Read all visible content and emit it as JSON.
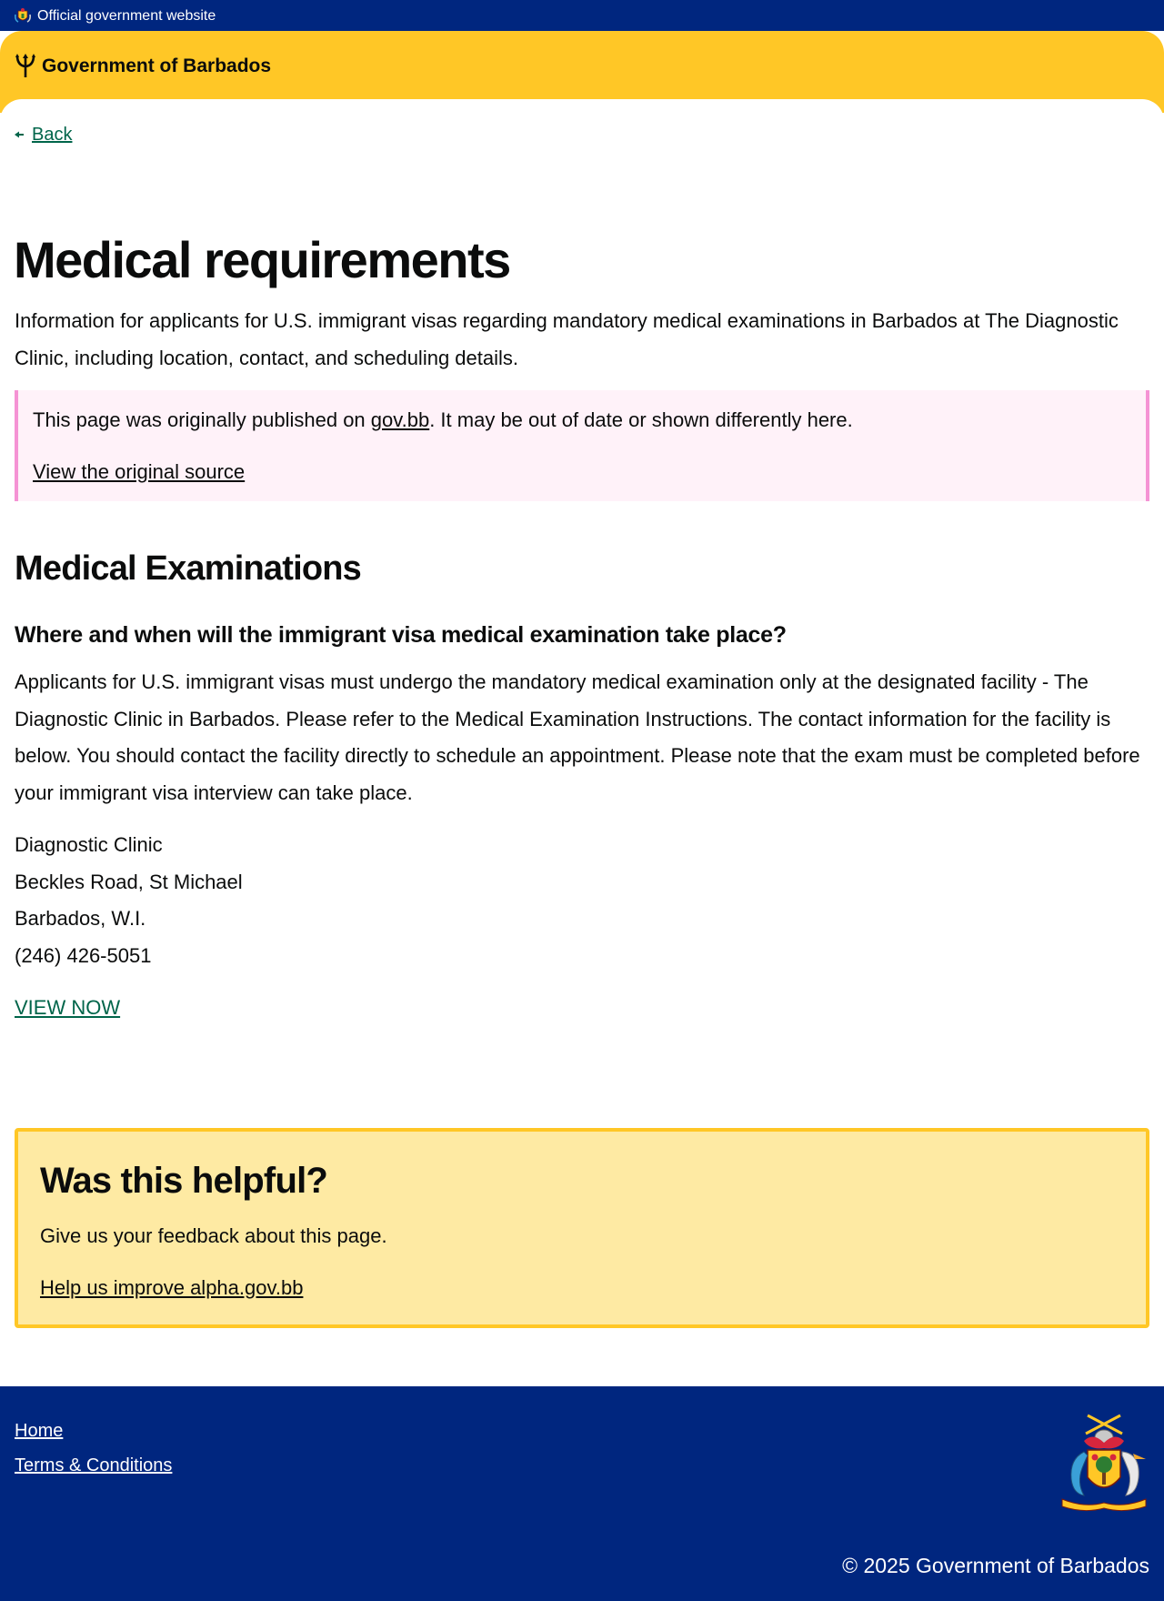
{
  "topbar": {
    "official_text": "Official government website",
    "icon": "coat-of-arms-icon"
  },
  "header": {
    "brand": "Government of Barbados",
    "icon": "trident-icon"
  },
  "nav": {
    "back_label": "Back"
  },
  "page": {
    "title": "Medical requirements",
    "lede": "Information for applicants for U.S. immigrant visas regarding mandatory medical examinations in Barbados at The Diagnostic Clinic, including location, contact, and scheduling details."
  },
  "notice": {
    "text_before": "This page was originally published on ",
    "link_text": "gov.bb",
    "text_after": ". It may be out of date or shown differently here.",
    "source_link": "View the original source"
  },
  "content": {
    "heading": "Medical Examinations",
    "subheading": "Where and when will the immigrant visa medical examination take place?",
    "paragraph": "Applicants for U.S. immigrant visas must undergo the mandatory medical examination only at the designated facility - The Diagnostic Clinic in Barbados. Please refer to the Medical Examination Instructions. The contact information for the facility is below. You should contact the facility directly to schedule an appointment. Please note that the exam must be completed before your immigrant visa interview can take place.",
    "address": {
      "name": "Diagnostic Clinic",
      "street": "Beckles Road, St Michael",
      "country": "Barbados, W.I.",
      "phone": "(246) 426-5051"
    },
    "view_now": "VIEW NOW"
  },
  "feedback": {
    "title": "Was this helpful?",
    "text": "Give us your feedback about this page.",
    "link": "Help us improve alpha.gov.bb"
  },
  "footer": {
    "home": "Home",
    "terms": "Terms & Conditions",
    "copyright": "© 2025 Government of Barbados"
  },
  "colors": {
    "navy": "#00267f",
    "gold": "#ffc726",
    "link_green": "#00654a",
    "notice_bg": "#fff2f9",
    "notice_border": "#f593d4",
    "feedback_bg": "#feeaa3"
  }
}
